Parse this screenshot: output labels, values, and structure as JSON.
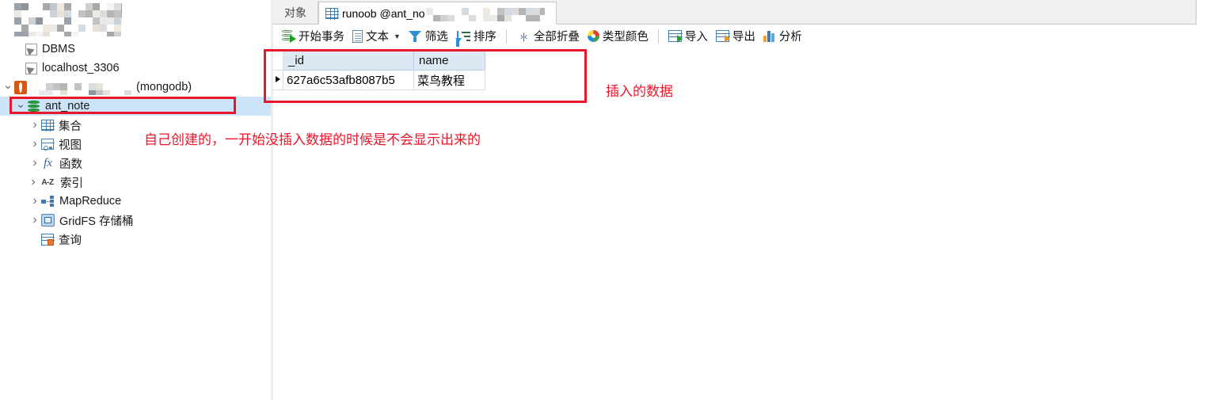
{
  "sidebar": {
    "logo": {
      "icon": "blurred-logo-mosaic",
      "redacted": true
    },
    "items": [
      {
        "label": "DBMS",
        "icon": "connection-icon",
        "indent": 16,
        "twisty": "none"
      },
      {
        "label": "localhost_3306",
        "icon": "connection-icon",
        "indent": 16,
        "twisty": "none"
      },
      {
        "label": "(mongodb)",
        "icon": "mongodb-leaf-icon",
        "indent": 0,
        "twisty": "open",
        "redacted_prefix": true
      },
      {
        "label": "ant_note",
        "icon": "database-icon",
        "indent": 16,
        "twisty": "open",
        "selected": true
      },
      {
        "label": "集合",
        "icon": "collection-table-icon",
        "indent": 36,
        "twisty": "closed"
      },
      {
        "label": "视图",
        "icon": "view-icon",
        "indent": 36,
        "twisty": "closed"
      },
      {
        "label": "函数",
        "icon": "function-fx-icon",
        "indent": 36,
        "twisty": "closed"
      },
      {
        "label": "索引",
        "icon": "index-az-icon",
        "indent": 36,
        "twisty": "closed"
      },
      {
        "label": "MapReduce",
        "icon": "mapreduce-icon",
        "indent": 36,
        "twisty": "closed"
      },
      {
        "label": "GridFS 存储桶",
        "icon": "gridfs-bucket-icon",
        "indent": 36,
        "twisty": "closed"
      },
      {
        "label": "查询",
        "icon": "query-icon",
        "indent": 36,
        "twisty": "none"
      }
    ]
  },
  "tabs": [
    {
      "label": "对象",
      "active": false,
      "icon": null
    },
    {
      "label": "runoob @ant_no",
      "active": true,
      "icon": "grid-table-icon",
      "redacted_suffix": true
    }
  ],
  "toolbar": {
    "items": [
      {
        "label": "开始事务",
        "icon": "begin-transaction-icon"
      },
      {
        "label": "文本",
        "icon": "text-document-icon",
        "has_dropdown": true
      },
      {
        "label": "筛选",
        "icon": "filter-funnel-icon"
      },
      {
        "label": "排序",
        "icon": "sort-icon"
      },
      {
        "label": "全部折叠",
        "icon": "collapse-all-icon"
      },
      {
        "label": "类型颜色",
        "icon": "type-color-wheel-icon"
      },
      {
        "label": "导入",
        "icon": "import-icon"
      },
      {
        "label": "导出",
        "icon": "export-icon"
      },
      {
        "label": "分析",
        "icon": "analyze-chart-icon"
      }
    ]
  },
  "grid": {
    "columns": [
      "_id",
      "name"
    ],
    "rows": [
      {
        "marker": true,
        "_id": "627a6c53afb8087b5",
        "name": "菜鸟教程"
      }
    ]
  },
  "annotations": {
    "inserted_data": "插入的数据",
    "self_created": "自己创建的，一开始没插入数据的时候是不会显示出来的"
  },
  "colors": {
    "annotation_red": "#f01428",
    "selection_blue": "#cce4f7",
    "header_blue": "#dce9f5",
    "mongodb_orange": "#d9560f",
    "database_green": "#26a63a"
  }
}
